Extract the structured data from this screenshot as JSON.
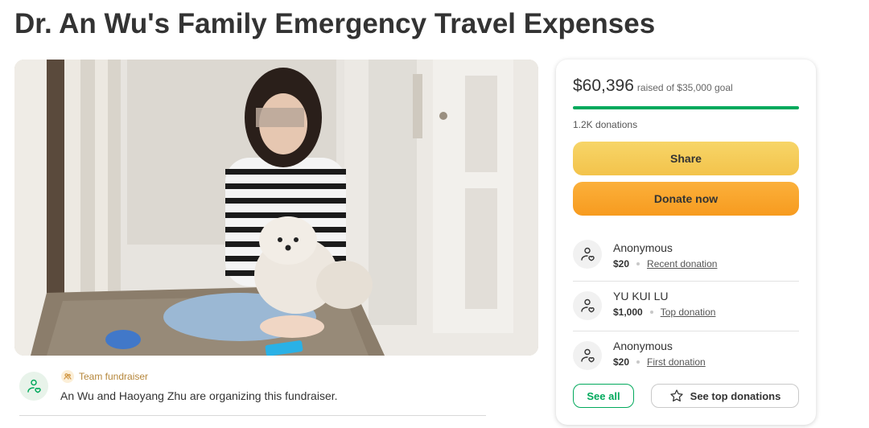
{
  "page": {
    "title": "Dr. An Wu's Family Emergency Travel Expenses"
  },
  "organizer": {
    "tag": "Team fundraiser",
    "text": "An Wu and Haoyang Zhu are organizing this fundraiser."
  },
  "donation_card": {
    "raised": "$60,396",
    "goal_text": "raised of $35,000 goal",
    "progress_fraction": 1.0,
    "donation_count": "1.2K donations",
    "share_label": "Share",
    "donate_label": "Donate now",
    "donations": [
      {
        "name": "Anonymous",
        "amount": "$20",
        "label": "Recent donation"
      },
      {
        "name": "YU KUI LU",
        "amount": "$1,000",
        "label": "Top donation"
      },
      {
        "name": "Anonymous",
        "amount": "$20",
        "label": "First donation"
      }
    ],
    "see_all_label": "See all",
    "see_top_label": "See top donations"
  },
  "colors": {
    "brand_green": "#02a95c",
    "share_yellow": "#f3c34b",
    "donate_orange": "#f79b1f"
  },
  "icons": {
    "organizer": "heart-hand-icon",
    "team": "team-icon",
    "donor": "heart-hand-icon",
    "star": "star-icon"
  }
}
